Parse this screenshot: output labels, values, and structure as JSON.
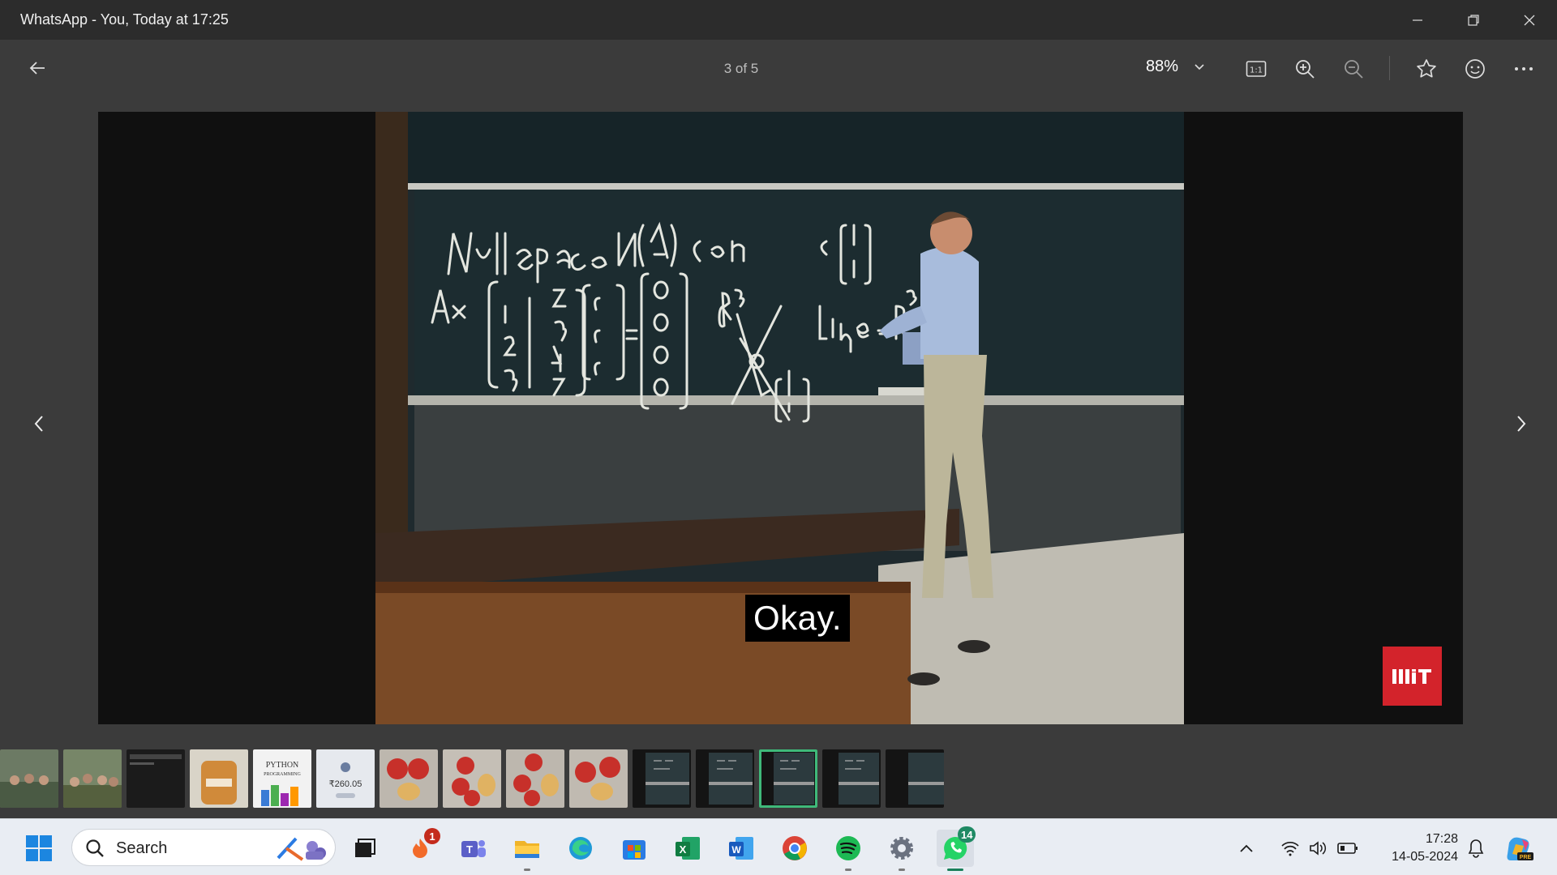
{
  "window": {
    "title": "WhatsApp - You, Today at 17:25"
  },
  "toolbar": {
    "counter": "3 of 5",
    "zoom_level": "88%"
  },
  "video": {
    "caption": "Okay.",
    "logo_text": "MIT"
  },
  "filmstrip": {
    "thumb_price_text": "₹260.05",
    "thumb_book_text": "PYTHON PROGRAMMING",
    "active_index": 12
  },
  "taskbar": {
    "search_placeholder": "Search",
    "badges": {
      "app1": "1",
      "whatsapp": "14"
    },
    "time": "17:28",
    "date": "14-05-2024"
  },
  "colors": {
    "accent_green": "#3fb97a",
    "mit_red": "#d3232b",
    "badge_red": "#c42b1c",
    "badge_green": "#1f8a64"
  }
}
